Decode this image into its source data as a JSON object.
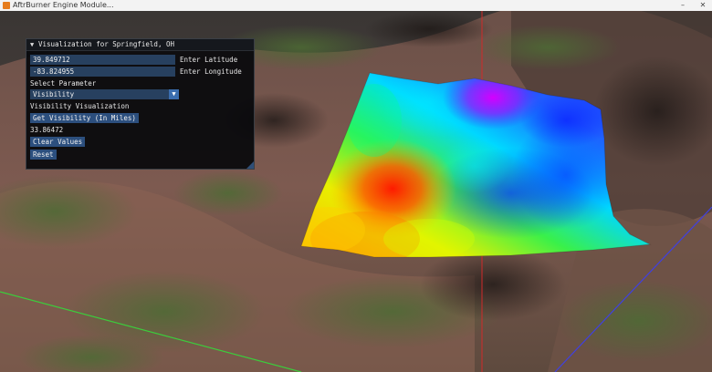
{
  "window": {
    "title": "AftrBurner Engine Module..."
  },
  "panel": {
    "title": "Visualization for Springfield, OH",
    "latitude_value": "39.849712",
    "latitude_label": "Enter Latitude",
    "longitude_value": "-83.824955",
    "longitude_label": "Enter Longitude",
    "select_parameter_label": "Select Parameter",
    "parameter_selected": "Visibility",
    "section_label": "Visibility Visualization",
    "get_button_label": "Get Visibility (In Miles)",
    "result_value": "33.86472",
    "clear_button_label": "Clear Values",
    "reset_button_label": "Reset"
  },
  "colors": {
    "panel_bg": "#08090c",
    "field_bg": "#27405f",
    "button_bg": "#2c4f7e",
    "axis_red": "#d02a2a",
    "axis_blue": "#4040e0",
    "axis_green": "#3ccc3c"
  }
}
